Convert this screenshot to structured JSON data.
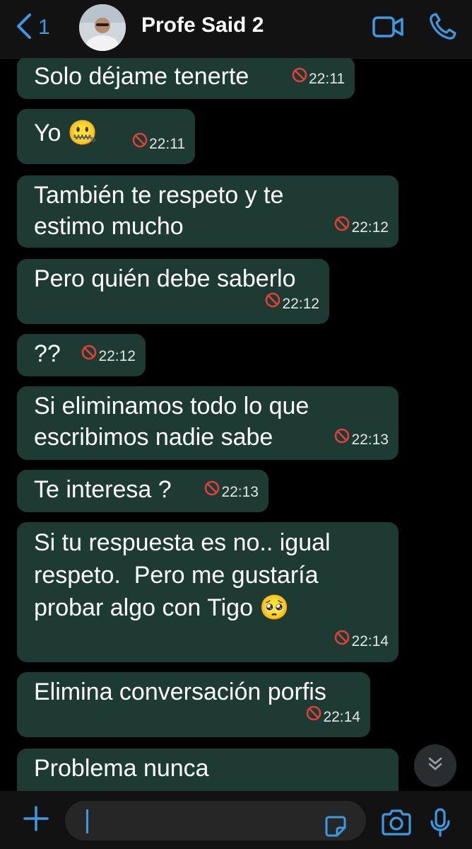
{
  "header": {
    "back_count": "1",
    "contact_name": "Profe Said 2"
  },
  "messages": [
    {
      "text": "Solo déjame tenerte",
      "time": "22:11"
    },
    {
      "text": "Yo 🤐",
      "time": "22:11"
    },
    {
      "text": "También te respeto y te\nestimo mucho",
      "time": "22:12"
    },
    {
      "text": "Pero quién debe saberlo",
      "time": "22:12"
    },
    {
      "text": "??",
      "time": "22:12"
    },
    {
      "text": "Si eliminamos todo lo que\nescribimos nadie sabe",
      "time": "22:13"
    },
    {
      "text": "Te interesa ?",
      "time": "22:13"
    },
    {
      "text": "Si tu respuesta es no.. igual\nrespeto.  Pero me gustaría\nprobar algo con Tigo 🥺",
      "time": "22:14"
    },
    {
      "text": "Elimina conversación porfis",
      "time": "22:14"
    },
    {
      "text": "Problema nunca",
      "time": ""
    }
  ],
  "icons": {
    "back": "chevron-left-icon",
    "video": "video-camera-icon",
    "call": "phone-icon",
    "deleted": "no-entry-icon",
    "scroll": "chevron-double-down-icon",
    "attach": "plus-icon",
    "sticker": "sticker-icon",
    "camera": "camera-icon",
    "mic": "microphone-icon"
  },
  "colors": {
    "accent": "#3b9ae1",
    "bubble": "#1d3b33",
    "deleted_icon": "#e0403a"
  }
}
